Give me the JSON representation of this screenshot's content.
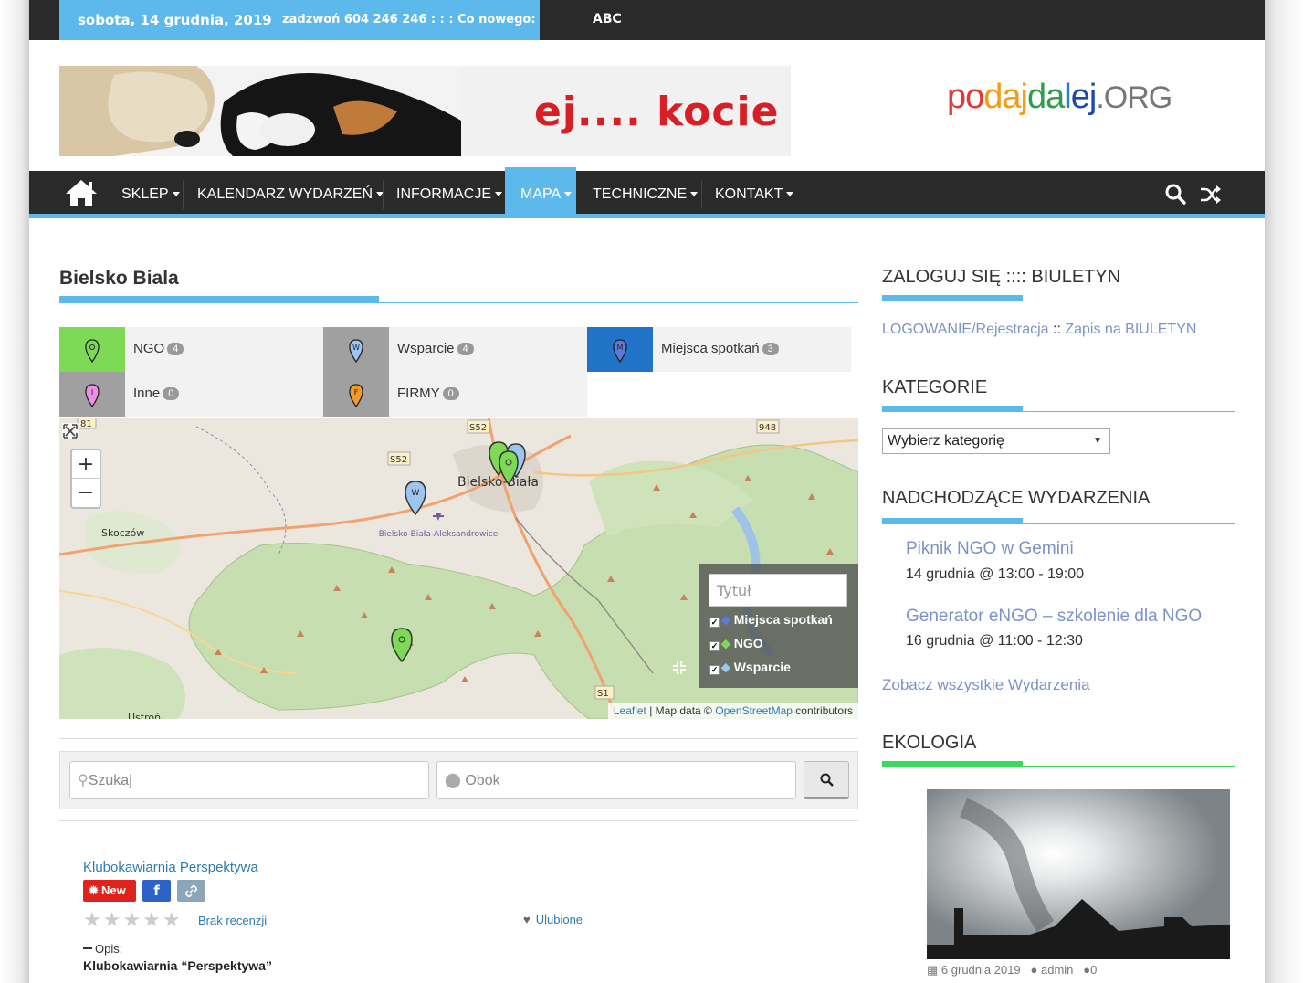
{
  "topbar": {
    "date": "sobota, 14 grudnia, 2019",
    "phone": "zadzwoń 604 246 246 : : : Co nowego:",
    "ticker": "ABC"
  },
  "header": {
    "banner_text": "ej.... kocie",
    "logo": {
      "p1": "po",
      "p2": "daj",
      "p3": "da",
      "p4": "l",
      "p5": "ej",
      "org": ".ORG"
    }
  },
  "nav": {
    "items": [
      {
        "label": "SKLEP"
      },
      {
        "label": "KALENDARZ WYDARZEŃ"
      },
      {
        "label": "INFORMACJE"
      },
      {
        "label": "MAPA"
      },
      {
        "label": "TECHNICZNE"
      },
      {
        "label": "KONTAKT"
      }
    ],
    "active": "MAPA"
  },
  "main": {
    "title": "Bielsko Biala",
    "categories": [
      {
        "label": "NGO",
        "count": "4",
        "color": "#7ed957",
        "letter": ""
      },
      {
        "label": "Wsparcie",
        "count": "4",
        "color": "#a0a0a0",
        "letter": "W"
      },
      {
        "label": "Miejsca spotkań",
        "count": "3",
        "color": "#2173c8",
        "letter": "M"
      },
      {
        "label": "Inne",
        "count": "0",
        "color": "#a0a0a0",
        "letter": "I"
      },
      {
        "label": "FIRMY",
        "count": "0",
        "color": "#a0a0a0",
        "letter": "F"
      }
    ],
    "map": {
      "city_label": "Bielsko-Biała",
      "airport_label": "Bielsko-Biała-Aleksandrowice",
      "town_label": "Skoczów",
      "town2_label": "Ustroń",
      "road_labels": [
        "S52",
        "S52",
        "948",
        "81",
        "S1"
      ],
      "zoom_in": "+",
      "zoom_out": "−",
      "filter_placeholder": "Tytuł",
      "layers": [
        "Miejsca spotkań",
        "NGO",
        "Wsparcie"
      ],
      "attribution_leaflet": "Leaflet",
      "attribution_mid": "| Map data ©",
      "attribution_osm": "OpenStreetMap",
      "attribution_end": "contributors"
    },
    "search": {
      "query_placeholder": "Szukaj",
      "near_placeholder": "Obok"
    },
    "listing": {
      "title": "Klubokawiarnia Perspektywa",
      "new_label": "New",
      "fb_label": "f",
      "stars": "★★★★★",
      "no_review": "Brak recenzji",
      "favorite": "Ulubione",
      "desc_label": "Opis:",
      "desc_text": "Klubokawiarnia “Perspektywa”"
    }
  },
  "sidebar": {
    "login_title": "ZALOGUJ SIĘ :::: BIULETYN",
    "login_link": "LOGOWANIE/Rejestracja",
    "login_sep": "::",
    "newsletter_link": "Zapis na BIULETYN",
    "categories_title": "KATEGORIE",
    "categories_select": "Wybierz kategorię",
    "events_title": "NADCHODZĄCE WYDARZENIA",
    "events": [
      {
        "title": "Piknik NGO w Gemini",
        "date": "14 grudnia @ 13:00 - 19:00"
      },
      {
        "title": "Generator eNGO – szkolenie dla NGO",
        "date": "16 grudnia @ 11:00 - 12:30"
      }
    ],
    "all_events": "Zobacz wszystkie Wydarzenia",
    "eco_title": "EKOLOGIA",
    "eco_date": "6 grudnia 2019",
    "eco_author": "admin",
    "eco_comments": "0"
  }
}
